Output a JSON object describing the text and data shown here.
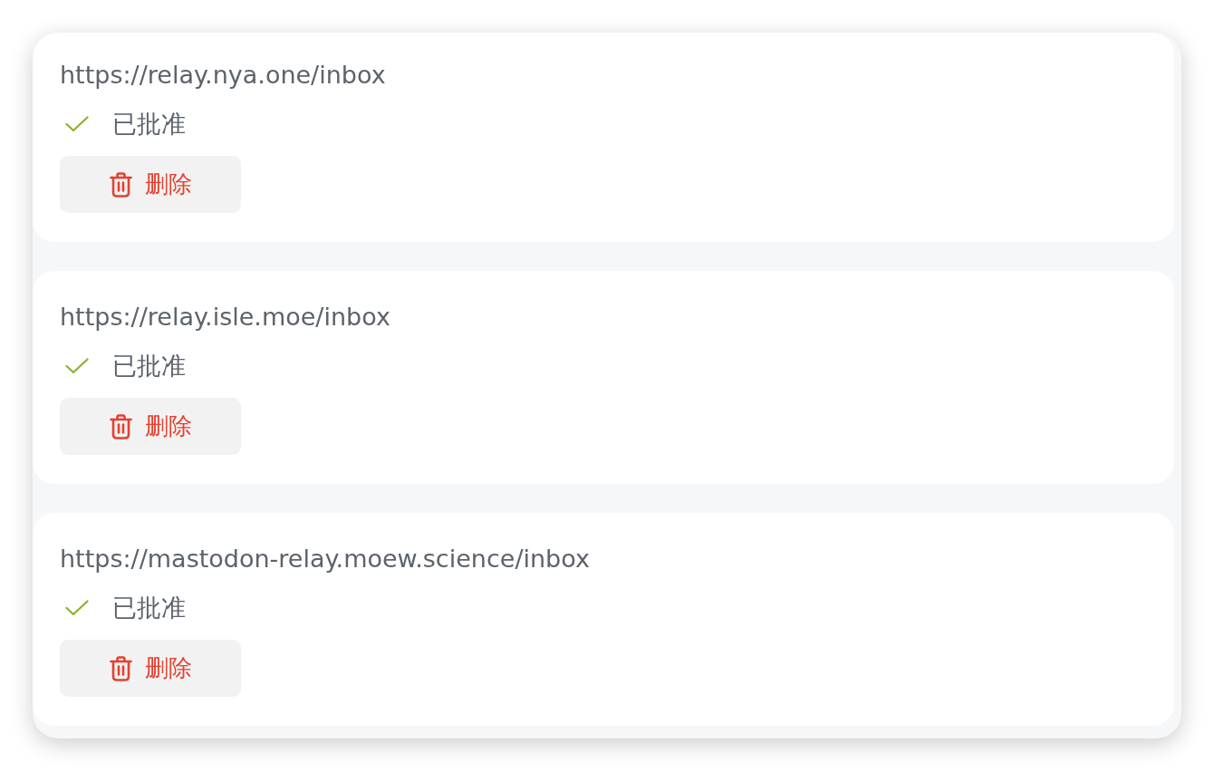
{
  "relays": [
    {
      "url": "https://relay.nya.one/inbox",
      "status": {
        "kind": "approved",
        "label": "已批准"
      },
      "delete_button": {
        "label": "删除"
      }
    },
    {
      "url": "https://relay.isle.moe/inbox",
      "status": {
        "kind": "approved",
        "label": "已批准"
      },
      "delete_button": {
        "label": "删除"
      }
    },
    {
      "url": "https://mastodon-relay.moew.science/inbox",
      "status": {
        "kind": "approved",
        "label": "已批准"
      },
      "delete_button": {
        "label": "删除"
      }
    }
  ]
}
